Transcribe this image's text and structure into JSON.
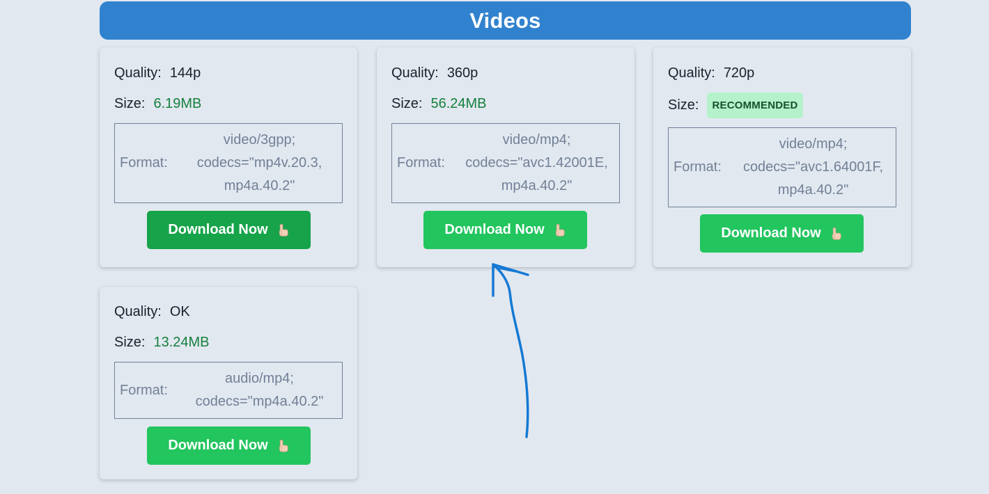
{
  "header": {
    "title": "Videos"
  },
  "labels": {
    "quality": "Quality:",
    "size": "Size:",
    "format": "Format:"
  },
  "cards": [
    {
      "quality": "144p",
      "size": "6.19MB",
      "format": "video/3gpp; codecs=\"mp4v.20.3, mp4a.40.2\"",
      "button": "Download Now"
    },
    {
      "quality": "360p",
      "size": "56.24MB",
      "format": "video/mp4; codecs=\"avc1.42001E, mp4a.40.2\"",
      "button": "Download Now"
    },
    {
      "quality": "720p",
      "badge": "RECOMMENDED",
      "format": "video/mp4; codecs=\"avc1.64001F, mp4a.40.2\"",
      "button": "Download Now"
    },
    {
      "quality": "OK",
      "size": "13.24MB",
      "format": "audio/mp4; codecs=\"mp4a.40.2\"",
      "button": "Download Now"
    }
  ],
  "icons": {
    "button_icon": "hand-pointing-down-icon",
    "annotation": "hand-drawn-arrow-icon"
  },
  "colors": {
    "header": "#3182ce",
    "button": "#22c55e",
    "button_active": "#16a34a",
    "size_text": "#15803d",
    "badge_bg": "#b4f2cc",
    "arrow": "#1479d4"
  }
}
